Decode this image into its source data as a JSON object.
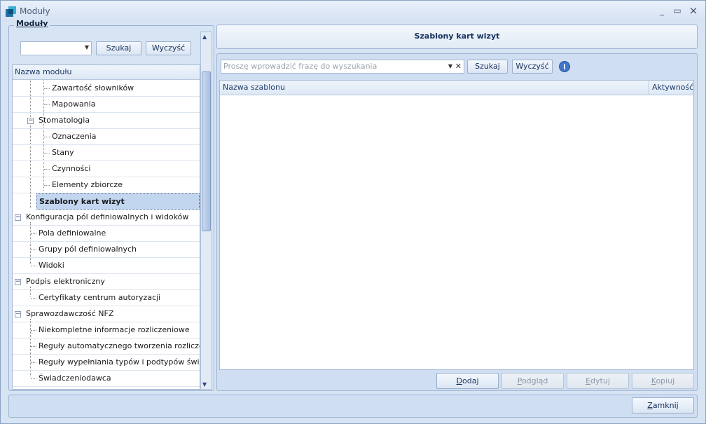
{
  "window": {
    "title": "Moduły",
    "minimize_glyph": "_",
    "maximize_glyph": "▭",
    "close_glyph": "×"
  },
  "left": {
    "group_label": "Moduły",
    "search_button": "Szukaj",
    "clear_button": "Wyczyść",
    "tree_header": "Nazwa modułu",
    "tree_items": [
      {
        "label": "Zawartość słowników"
      },
      {
        "label": "Mapowania"
      },
      {
        "label": "Stomatologia"
      },
      {
        "label": "Oznaczenia"
      },
      {
        "label": "Stany"
      },
      {
        "label": "Czynności"
      },
      {
        "label": "Elementy zbiorcze"
      },
      {
        "label": "Szablony kart wizyt"
      },
      {
        "label": "Konfiguracja pól definiowalnych i widoków"
      },
      {
        "label": "Pola definiowalne"
      },
      {
        "label": "Grupy pól definiowalnych"
      },
      {
        "label": "Widoki"
      },
      {
        "label": "Podpis elektroniczny"
      },
      {
        "label": "Certyfikaty centrum autoryzacji"
      },
      {
        "label": "Sprawozdawczość NFZ"
      },
      {
        "label": "Niekompletne informacje rozliczeniowe"
      },
      {
        "label": "Reguły automatycznego tworzenia rozliczeń"
      },
      {
        "label": "Reguły wypełniania typów i podtypów świad…"
      },
      {
        "label": "Świadczeniodawca"
      }
    ],
    "expander_glyph": "−"
  },
  "right": {
    "title": "Szablony kart wizyt",
    "search_placeholder": "Proszę wprowadzić frazę do wyszukania",
    "search_button": "Szukaj",
    "clear_button": "Wyczyść",
    "info_icon": "i",
    "columns": [
      "Nazwa szablonu",
      "Aktywność"
    ],
    "buttons": {
      "add": "Dodaj",
      "preview": "Podgląd",
      "edit": "Edytuj",
      "copy": "Kopiuj"
    }
  },
  "bottom": {
    "close_button": "Zamknij"
  },
  "colors": {
    "accent": "#3f76c9",
    "selected_row": "#c2d6f0",
    "window_bg": "#d7e4f4"
  }
}
